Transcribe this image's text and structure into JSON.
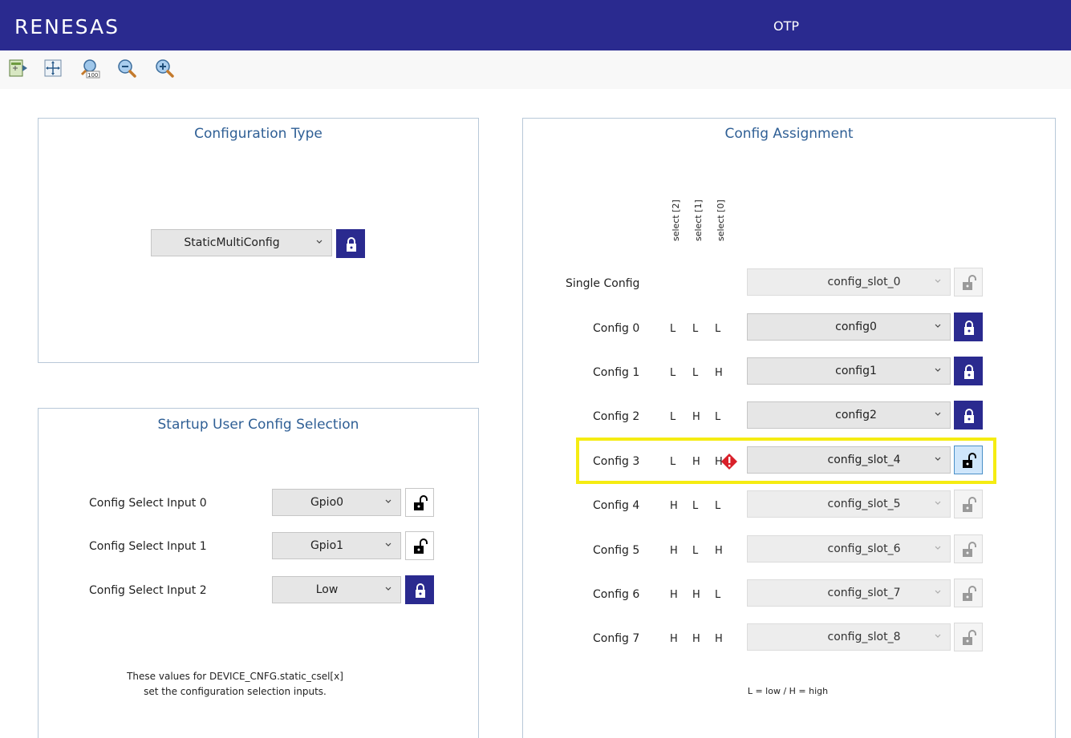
{
  "header": {
    "logo": "RENESAS",
    "title": "OTP"
  },
  "toolbar": {
    "icons": [
      "fit-to-window-icon",
      "pan-icon",
      "zoom-100-icon",
      "zoom-out-icon",
      "zoom-in-icon"
    ]
  },
  "config_type": {
    "title": "Configuration Type",
    "value": "StaticMultiConfig",
    "lock_state": "locked"
  },
  "startup": {
    "title": "Startup User Config Selection",
    "rows": [
      {
        "label": "Config Select Input 0",
        "value": "Gpio0",
        "lock_state": "unlocked"
      },
      {
        "label": "Config Select Input 1",
        "value": "Gpio1",
        "lock_state": "unlocked"
      },
      {
        "label": "Config Select Input 2",
        "value": "Low",
        "lock_state": "locked"
      }
    ],
    "note_line1": "These values for DEVICE_CNFG.static_csel[x]",
    "note_line2": "set the configuration selection inputs."
  },
  "assignment": {
    "title": "Config Assignment",
    "headers": [
      "select [2]",
      "select [1]",
      "select [0]"
    ],
    "single": {
      "label": "Single Config",
      "value": "config_slot_0",
      "lock_state": "disabled"
    },
    "rows": [
      {
        "label": "Config 0",
        "s2": "L",
        "s1": "L",
        "s0": "L",
        "value": "config0",
        "lock_state": "locked"
      },
      {
        "label": "Config 1",
        "s2": "L",
        "s1": "L",
        "s0": "H",
        "value": "config1",
        "lock_state": "locked"
      },
      {
        "label": "Config 2",
        "s2": "L",
        "s1": "H",
        "s0": "L",
        "value": "config2",
        "lock_state": "locked"
      },
      {
        "label": "Config 3",
        "s2": "L",
        "s1": "H",
        "s0": "H",
        "value": "config_slot_4",
        "lock_state": "unlocked-highlighted",
        "warning": true
      },
      {
        "label": "Config 4",
        "s2": "H",
        "s1": "L",
        "s0": "L",
        "value": "config_slot_5",
        "lock_state": "disabled"
      },
      {
        "label": "Config 5",
        "s2": "H",
        "s1": "L",
        "s0": "H",
        "value": "config_slot_6",
        "lock_state": "disabled"
      },
      {
        "label": "Config 6",
        "s2": "H",
        "s1": "H",
        "s0": "L",
        "value": "config_slot_7",
        "lock_state": "disabled"
      },
      {
        "label": "Config 7",
        "s2": "H",
        "s1": "H",
        "s0": "H",
        "value": "config_slot_8",
        "lock_state": "disabled"
      }
    ],
    "legend": "L = low / H = high"
  },
  "colors": {
    "brand": "#2a2a8f",
    "title_blue": "#2f5f95",
    "highlight": "#f5ec12",
    "warning": "#d9202a"
  }
}
